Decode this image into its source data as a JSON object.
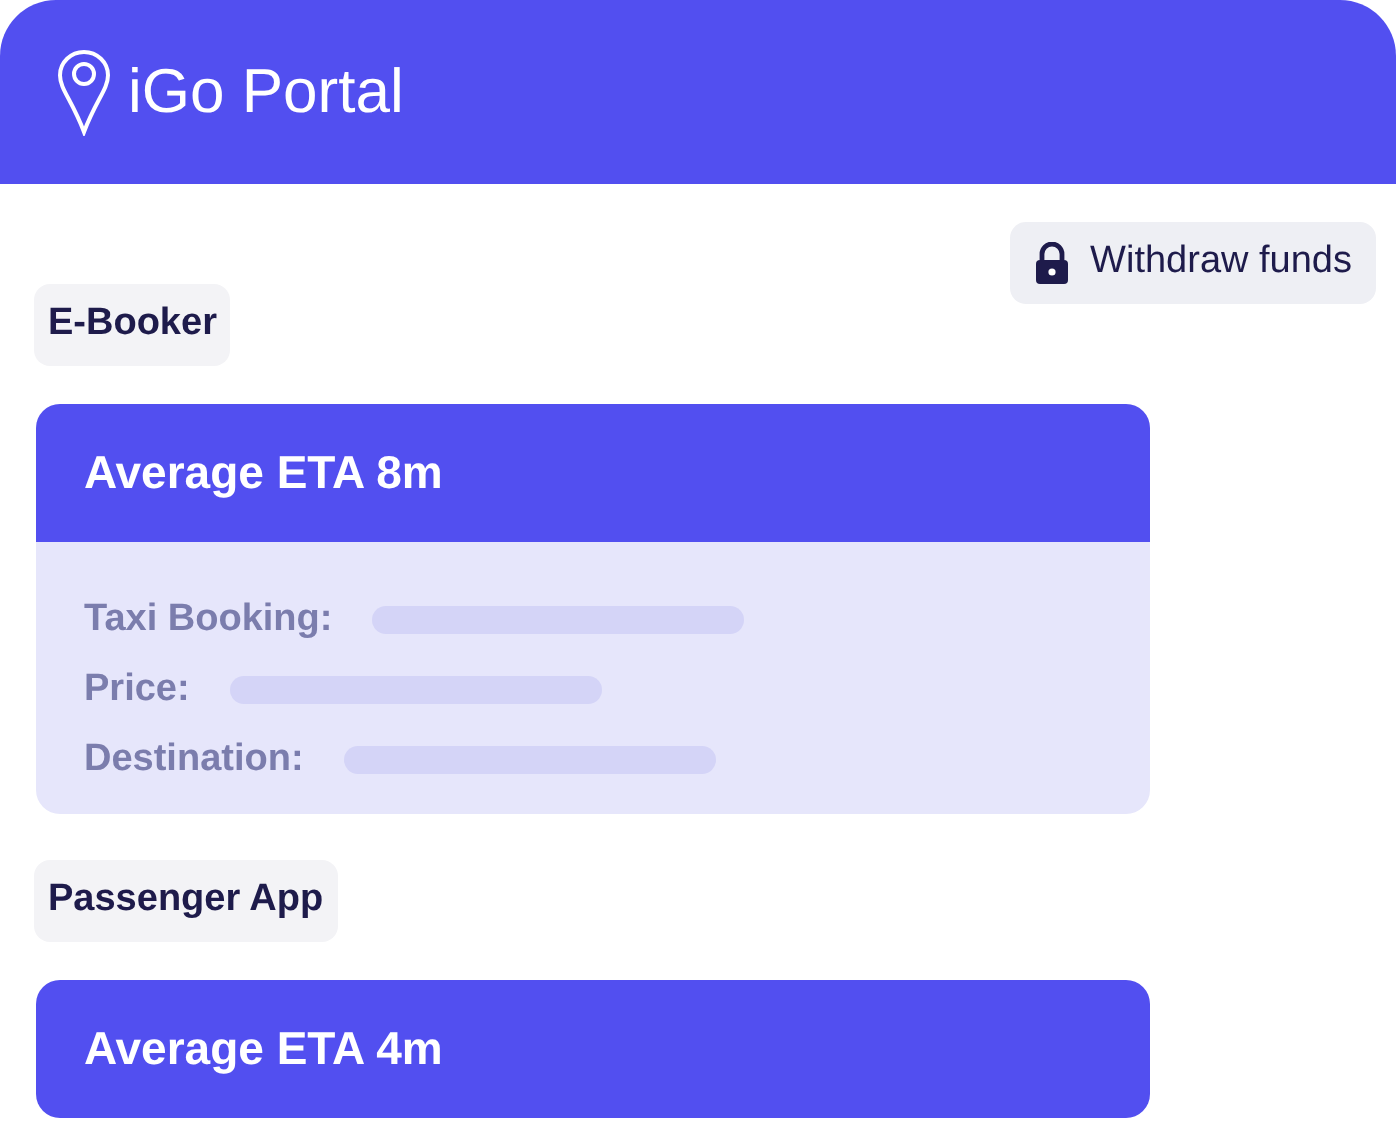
{
  "header": {
    "title": "iGo Portal"
  },
  "withdraw_button": {
    "label": "Withdraw funds"
  },
  "sections": [
    {
      "label": "E-Booker",
      "card": {
        "title": "Average ETA 8m",
        "fields": [
          "Taxi Booking:",
          "Price:",
          "Destination:"
        ]
      }
    },
    {
      "label": "Passenger App",
      "card": {
        "title": "Average ETA 4m"
      }
    }
  ]
}
